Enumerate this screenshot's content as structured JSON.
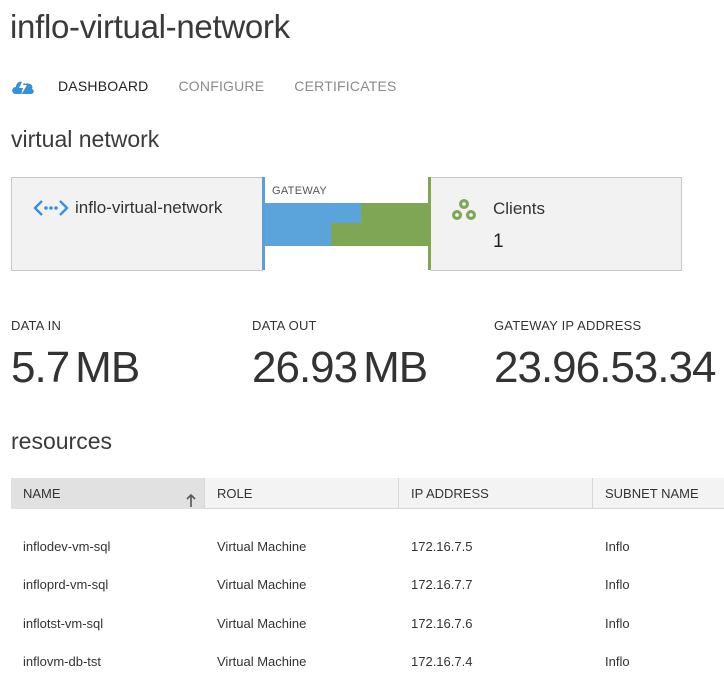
{
  "page": {
    "title": "inflo-virtual-network"
  },
  "tabs": [
    {
      "label": "DASHBOARD",
      "active": true
    },
    {
      "label": "CONFIGURE",
      "active": false
    },
    {
      "label": "CERTIFICATES",
      "active": false
    }
  ],
  "tab_icon": "quickstart-cloud-icon",
  "virtual_network": {
    "heading": "virtual network",
    "network_name": "inflo-virtual-network",
    "gateway_label": "GATEWAY",
    "clients_label": "Clients",
    "clients_count": "1",
    "colors": {
      "data_in": "#5ba3db",
      "data_out": "#7ea655"
    }
  },
  "stats": {
    "data_in": {
      "label": "DATA IN",
      "value": "5.7",
      "unit": "MB"
    },
    "data_out": {
      "label": "DATA OUT",
      "value": "26.93",
      "unit": "MB"
    },
    "gateway_ip": {
      "label": "GATEWAY IP ADDRESS",
      "value": "23.96.53.34"
    }
  },
  "resources": {
    "heading": "resources",
    "columns": [
      "NAME",
      "ROLE",
      "IP ADDRESS",
      "SUBNET NAME"
    ],
    "sort_column": "NAME",
    "rows": [
      {
        "name": "inflodev-vm-sql",
        "role": "Virtual Machine",
        "ip": "172.16.7.5",
        "subnet": "Inflo"
      },
      {
        "name": "infloprd-vm-sql",
        "role": "Virtual Machine",
        "ip": "172.16.7.7",
        "subnet": "Inflo"
      },
      {
        "name": "inflotst-vm-sql",
        "role": "Virtual Machine",
        "ip": "172.16.7.6",
        "subnet": "Inflo"
      },
      {
        "name": "inflovm-db-tst",
        "role": "Virtual Machine",
        "ip": "172.16.7.4",
        "subnet": "Inflo"
      }
    ]
  }
}
